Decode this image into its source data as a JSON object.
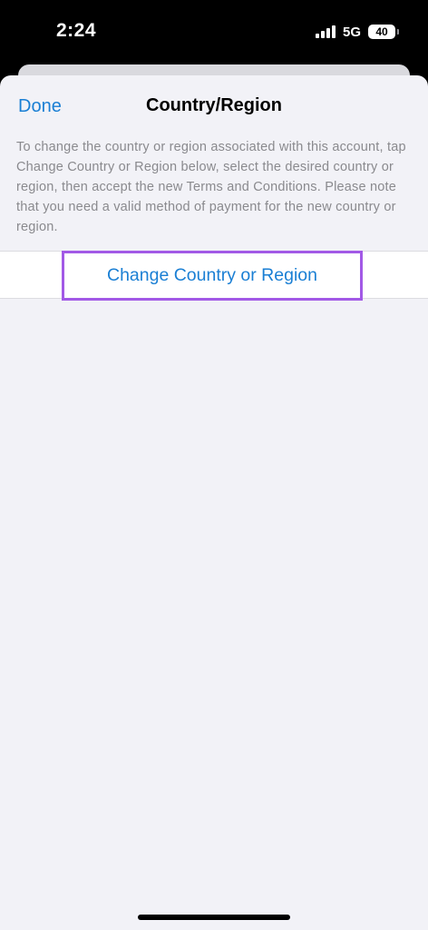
{
  "status_bar": {
    "time": "2:24",
    "network": "5G",
    "battery": "40",
    "icons": [
      "signal-icon",
      "battery-icon"
    ]
  },
  "nav": {
    "done_label": "Done",
    "title": "Country/Region"
  },
  "description": "To change the country or region associated with this account, tap Change Country or Region below, select the desired country or region, then accept the new Terms and Conditions. Please note that you need a valid method of payment for the new country or region.",
  "action": {
    "change_label": "Change Country or Region"
  },
  "colors": {
    "accent": "#1a7fd4",
    "highlight": "#a259e6",
    "background": "#f2f2f7"
  }
}
